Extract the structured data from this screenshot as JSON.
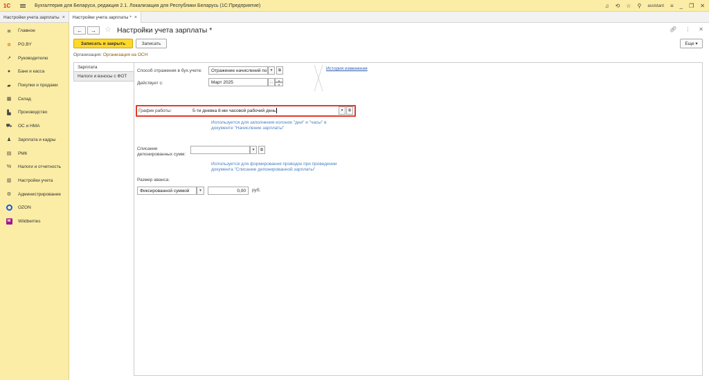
{
  "titlebar": {
    "logo": "1С",
    "title": "Бухгалтерия для Беларуси, редакция 2.1. Локализация для Республики Беларусь   (1С:Предприятие)",
    "user": "assistant"
  },
  "tabs": [
    {
      "label": "Настройки учета зарплаты"
    },
    {
      "label": "Настройки учета зарплаты *"
    }
  ],
  "sidebar": {
    "items": [
      {
        "label": "Главное",
        "icon": "≣"
      },
      {
        "label": "PO.BY",
        "icon": "✲"
      },
      {
        "label": "Руководителю",
        "icon": "↗"
      },
      {
        "label": "Банк и касса",
        "icon": "●"
      },
      {
        "label": "Покупки и продажи",
        "icon": "▰"
      },
      {
        "label": "Склад",
        "icon": "▦"
      },
      {
        "label": "Производство",
        "icon": "▙"
      },
      {
        "label": "ОС и НМА",
        "icon": "⛟"
      },
      {
        "label": "Зарплата и кадры",
        "icon": "♟"
      },
      {
        "label": "РМК",
        "icon": "▤"
      },
      {
        "label": "Налоги и отчетность",
        "icon": "%"
      },
      {
        "label": "Настройки учета",
        "icon": "▥"
      },
      {
        "label": "Администрирование",
        "icon": "⚙"
      },
      {
        "label": "OZON",
        "icon": "ozon"
      },
      {
        "label": "Wildberries",
        "icon": "W"
      }
    ]
  },
  "header": {
    "back": "←",
    "forward": "→",
    "title": "Настройки учета зарплаты *",
    "more_label": "Еще ▾"
  },
  "toolbar": {
    "save_close_label": "Записать и закрыть",
    "save_label": "Записать"
  },
  "organization": {
    "label": "Организация:",
    "value": "Организация на ОСН"
  },
  "vtabs": [
    {
      "label": "Зарплата"
    },
    {
      "label": "Налоги и взносы с ФОТ"
    }
  ],
  "form": {
    "reflection_label": "Способ отражения в бух.учете:",
    "reflection_value": "Отражение начислений по",
    "effective_label": "Действует с:",
    "effective_value": "Март 2025",
    "history_link": "История изменения",
    "schedule_label": "График работы:",
    "schedule_value": "5-ти дневка 8-ми часовой рабочий день",
    "schedule_hint_1": "Используется для заполнения колонок \"дни\" и \"часы\" в",
    "schedule_hint_2": "документе \"Начисление зарплаты\"",
    "deposit_label_1": "Списание",
    "deposit_label_2": "депонированных сумм:",
    "deposit_value": "",
    "deposit_hint_1": "Используется для формирования проводок при проведении",
    "deposit_hint_2": "документа \"Списание депонированной зарплаты\"",
    "advance_label": "Размер аванса:",
    "advance_type": "Фиксированной суммой",
    "advance_amount": "0,00",
    "advance_currency": "руб."
  }
}
